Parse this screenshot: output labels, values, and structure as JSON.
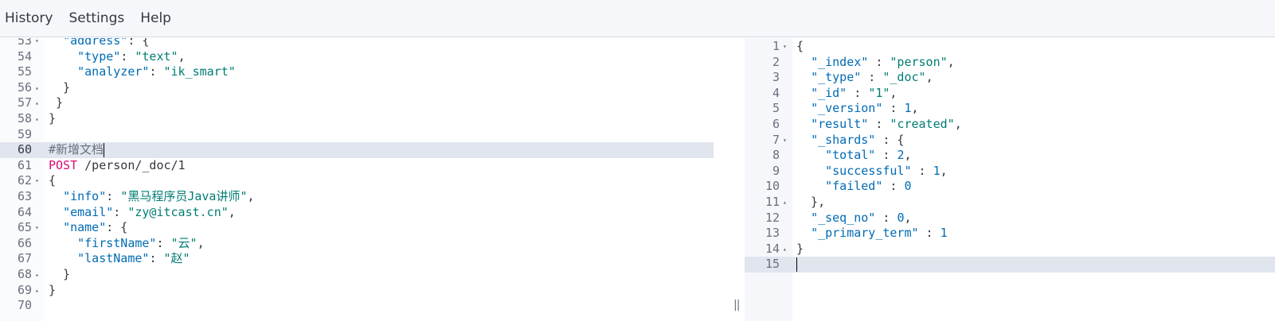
{
  "menu": {
    "history": "History",
    "settings": "Settings",
    "help": "Help"
  },
  "colors": {
    "key": "#006bb4",
    "string": "#017d73",
    "method": "#dd0a73",
    "active_line": "#e0e5ee"
  },
  "request_editor": {
    "lines": [
      {
        "num": "53",
        "fold": "▾",
        "tokens": [
          [
            "punc",
            "  "
          ],
          [
            "key",
            "\"address\""
          ],
          [
            "punc",
            ": {"
          ]
        ]
      },
      {
        "num": "54",
        "fold": "",
        "tokens": [
          [
            "punc",
            "    "
          ],
          [
            "key",
            "\"type\""
          ],
          [
            "punc",
            ": "
          ],
          [
            "str",
            "\"text\""
          ],
          [
            "punc",
            ","
          ]
        ]
      },
      {
        "num": "55",
        "fold": "",
        "tokens": [
          [
            "punc",
            "    "
          ],
          [
            "key",
            "\"analyzer\""
          ],
          [
            "punc",
            ": "
          ],
          [
            "str",
            "\"ik_smart\""
          ]
        ]
      },
      {
        "num": "56",
        "fold": "▴",
        "tokens": [
          [
            "punc",
            "  }"
          ]
        ]
      },
      {
        "num": "57",
        "fold": "▴",
        "tokens": [
          [
            "punc",
            " }"
          ]
        ]
      },
      {
        "num": "58",
        "fold": "▴",
        "tokens": [
          [
            "punc",
            "}"
          ]
        ]
      },
      {
        "num": "59",
        "fold": "",
        "tokens": []
      },
      {
        "num": "60",
        "fold": "",
        "active": true,
        "tokens": [
          [
            "comment",
            "#新增文档"
          ]
        ]
      },
      {
        "num": "61",
        "fold": "",
        "tokens": [
          [
            "method",
            "POST"
          ],
          [
            "url",
            " /person/_doc/1"
          ]
        ]
      },
      {
        "num": "62",
        "fold": "▾",
        "tokens": [
          [
            "punc",
            "{"
          ]
        ]
      },
      {
        "num": "63",
        "fold": "",
        "tokens": [
          [
            "punc",
            "  "
          ],
          [
            "key",
            "\"info\""
          ],
          [
            "punc",
            ": "
          ],
          [
            "str",
            "\"黑马程序员Java讲师\""
          ],
          [
            "punc",
            ","
          ]
        ]
      },
      {
        "num": "64",
        "fold": "",
        "tokens": [
          [
            "punc",
            "  "
          ],
          [
            "key",
            "\"email\""
          ],
          [
            "punc",
            ": "
          ],
          [
            "str",
            "\"zy@itcast.cn\""
          ],
          [
            "punc",
            ","
          ]
        ]
      },
      {
        "num": "65",
        "fold": "▾",
        "tokens": [
          [
            "punc",
            "  "
          ],
          [
            "key",
            "\"name\""
          ],
          [
            "punc",
            ": {"
          ]
        ]
      },
      {
        "num": "66",
        "fold": "",
        "tokens": [
          [
            "punc",
            "    "
          ],
          [
            "key",
            "\"firstName\""
          ],
          [
            "punc",
            ": "
          ],
          [
            "str",
            "\"云\""
          ],
          [
            "punc",
            ","
          ]
        ]
      },
      {
        "num": "67",
        "fold": "",
        "tokens": [
          [
            "punc",
            "    "
          ],
          [
            "key",
            "\"lastName\""
          ],
          [
            "punc",
            ": "
          ],
          [
            "str",
            "\"赵\""
          ]
        ]
      },
      {
        "num": "68",
        "fold": "▴",
        "tokens": [
          [
            "punc",
            "  }"
          ]
        ]
      },
      {
        "num": "69",
        "fold": "▴",
        "tokens": [
          [
            "punc",
            "}"
          ]
        ]
      },
      {
        "num": "70",
        "fold": "",
        "tokens": []
      }
    ]
  },
  "response_editor": {
    "lines": [
      {
        "num": "1",
        "fold": "▾",
        "tokens": [
          [
            "punc",
            "{"
          ]
        ]
      },
      {
        "num": "2",
        "fold": "",
        "tokens": [
          [
            "punc",
            "  "
          ],
          [
            "key",
            "\"_index\""
          ],
          [
            "punc",
            " : "
          ],
          [
            "str",
            "\"person\""
          ],
          [
            "punc",
            ","
          ]
        ]
      },
      {
        "num": "3",
        "fold": "",
        "tokens": [
          [
            "punc",
            "  "
          ],
          [
            "key",
            "\"_type\""
          ],
          [
            "punc",
            " : "
          ],
          [
            "str",
            "\"_doc\""
          ],
          [
            "punc",
            ","
          ]
        ]
      },
      {
        "num": "4",
        "fold": "",
        "tokens": [
          [
            "punc",
            "  "
          ],
          [
            "key",
            "\"_id\""
          ],
          [
            "punc",
            " : "
          ],
          [
            "str",
            "\"1\""
          ],
          [
            "punc",
            ","
          ]
        ]
      },
      {
        "num": "5",
        "fold": "",
        "tokens": [
          [
            "punc",
            "  "
          ],
          [
            "key",
            "\"_version\""
          ],
          [
            "punc",
            " : "
          ],
          [
            "num",
            "1"
          ],
          [
            "punc",
            ","
          ]
        ]
      },
      {
        "num": "6",
        "fold": "",
        "tokens": [
          [
            "punc",
            "  "
          ],
          [
            "key",
            "\"result\""
          ],
          [
            "punc",
            " : "
          ],
          [
            "str",
            "\"created\""
          ],
          [
            "punc",
            ","
          ]
        ]
      },
      {
        "num": "7",
        "fold": "▾",
        "tokens": [
          [
            "punc",
            "  "
          ],
          [
            "key",
            "\"_shards\""
          ],
          [
            "punc",
            " : {"
          ]
        ]
      },
      {
        "num": "8",
        "fold": "",
        "tokens": [
          [
            "punc",
            "    "
          ],
          [
            "key",
            "\"total\""
          ],
          [
            "punc",
            " : "
          ],
          [
            "num",
            "2"
          ],
          [
            "punc",
            ","
          ]
        ]
      },
      {
        "num": "9",
        "fold": "",
        "tokens": [
          [
            "punc",
            "    "
          ],
          [
            "key",
            "\"successful\""
          ],
          [
            "punc",
            " : "
          ],
          [
            "num",
            "1"
          ],
          [
            "punc",
            ","
          ]
        ]
      },
      {
        "num": "10",
        "fold": "",
        "tokens": [
          [
            "punc",
            "    "
          ],
          [
            "key",
            "\"failed\""
          ],
          [
            "punc",
            " : "
          ],
          [
            "num",
            "0"
          ]
        ]
      },
      {
        "num": "11",
        "fold": "▴",
        "tokens": [
          [
            "punc",
            "  },"
          ]
        ]
      },
      {
        "num": "12",
        "fold": "",
        "tokens": [
          [
            "punc",
            "  "
          ],
          [
            "key",
            "\"_seq_no\""
          ],
          [
            "punc",
            " : "
          ],
          [
            "num",
            "0"
          ],
          [
            "punc",
            ","
          ]
        ]
      },
      {
        "num": "13",
        "fold": "",
        "tokens": [
          [
            "punc",
            "  "
          ],
          [
            "key",
            "\"_primary_term\""
          ],
          [
            "punc",
            " : "
          ],
          [
            "num",
            "1"
          ]
        ]
      },
      {
        "num": "14",
        "fold": "▴",
        "tokens": [
          [
            "punc",
            "}"
          ]
        ]
      },
      {
        "num": "15",
        "fold": "",
        "active": true,
        "tokens": []
      }
    ]
  },
  "resizer_glyph": "||"
}
